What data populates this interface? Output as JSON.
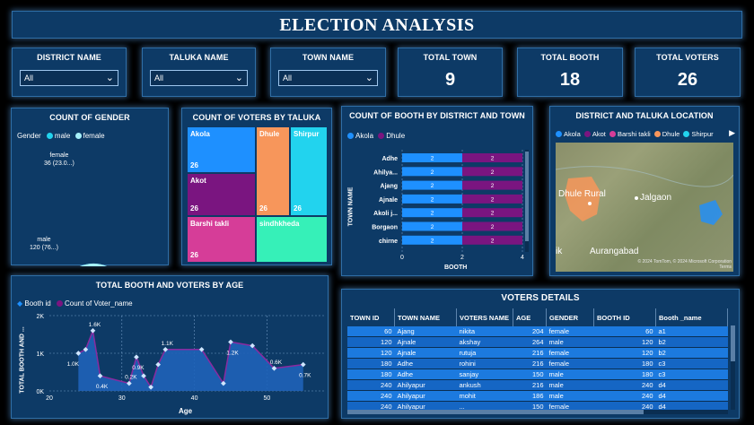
{
  "title": "ELECTION ANALYSIS",
  "filters": [
    {
      "label": "DISTRICT NAME",
      "value": "All"
    },
    {
      "label": "TALUKA NAME",
      "value": "All"
    },
    {
      "label": "TOWN NAME",
      "value": "All"
    }
  ],
  "cards": [
    {
      "label": "TOTAL TOWN",
      "value": "9"
    },
    {
      "label": "TOTAL BOOTH",
      "value": "18"
    },
    {
      "label": "TOTAL VOTERS",
      "value": "26"
    }
  ],
  "gender": {
    "title": "COUNT OF GENDER",
    "legend_title": "Gender",
    "legend": [
      {
        "name": "male",
        "color": "#22d3ee"
      },
      {
        "name": "female",
        "color": "#a5f0fa"
      }
    ],
    "female_label": "female",
    "female_value": "36 (23.0...)",
    "male_label": "male",
    "male_value": "120 (76...)",
    "female_fraction": 0.23
  },
  "treemap": {
    "title": "COUNT OF VOTERS BY  TALUKA",
    "items": [
      {
        "name": "Akola",
        "value": "26",
        "color": "#1e90ff"
      },
      {
        "name": "Dhule",
        "value": "26",
        "color": "#f7965b"
      },
      {
        "name": "Shirpur",
        "value": "26",
        "color": "#22d3ee"
      },
      {
        "name": "Akot",
        "value": "26",
        "color": "#7a1580"
      },
      {
        "name": "Barshi takli",
        "value": "26",
        "color": "#d63d98"
      },
      {
        "name": "sindhkheda",
        "value": "",
        "color": "#36f0b8"
      }
    ]
  },
  "booth_chart": {
    "title": "COUNT OF BOOTH BY DISTRICT AND TOWN",
    "legend": [
      {
        "name": "Akola",
        "color": "#1e90ff"
      },
      {
        "name": "Dhule",
        "color": "#7a1580"
      }
    ],
    "ylabel": "TOWN NAME",
    "xlabel": "BOOTH",
    "towns": [
      "Adhe",
      "Ahilya...",
      "Ajang",
      "Ajnale",
      "Akoli j...",
      "Borgaon",
      "chirne"
    ],
    "akola": [
      2,
      2,
      2,
      2,
      2,
      2,
      2
    ],
    "dhule": [
      2,
      2,
      2,
      2,
      2,
      2,
      2
    ],
    "xticks": [
      "0",
      "2",
      "4"
    ]
  },
  "map": {
    "title": "DISTRICT AND TALUKA LOCATION",
    "legend": [
      {
        "name": "Akola",
        "color": "#1e90ff"
      },
      {
        "name": "Akot",
        "color": "#7a1580"
      },
      {
        "name": "Barshi takli",
        "color": "#d63d98"
      },
      {
        "name": "Dhule",
        "color": "#f7965b"
      },
      {
        "name": "Shirpur",
        "color": "#22d3ee"
      }
    ],
    "place1": "Dhule Rural",
    "place2": "Jalgaon",
    "place3": "Aurangabad",
    "place4": "ik",
    "attribution": "© 2024 TomTom, © 2024 Microsoft Corporation Terms"
  },
  "age_chart": {
    "title": "TOTAL BOOTH AND VOTERS BY AGE",
    "legend": [
      {
        "name": "Booth id",
        "color": "#1e90ff"
      },
      {
        "name": "Count of Voter_name",
        "color": "#7a1580"
      }
    ],
    "ylabel": "TOTAL BOOTH AND ...",
    "xlabel": "Age",
    "yticks": [
      "2K",
      "1K",
      "0K"
    ],
    "xticks": [
      "20",
      "30",
      "40",
      "50"
    ],
    "labels": [
      "1.0K",
      "1.6K",
      "0.4K",
      "0.2K",
      "0.9K",
      "1.1K",
      "1.2K",
      "0.6K",
      "0.7K"
    ]
  },
  "chart_data": [
    {
      "type": "bar",
      "title": "COUNT OF BOOTH BY DISTRICT AND TOWN",
      "categories": [
        "Adhe",
        "Ahilya...",
        "Ajang",
        "Ajnale",
        "Akoli j...",
        "Borgaon",
        "chirne"
      ],
      "series": [
        {
          "name": "Akola",
          "values": [
            2,
            2,
            2,
            2,
            2,
            2,
            2
          ]
        },
        {
          "name": "Dhule",
          "values": [
            2,
            2,
            2,
            2,
            2,
            2,
            2
          ]
        }
      ],
      "xlabel": "BOOTH",
      "ylabel": "TOWN NAME",
      "xlim": [
        0,
        4
      ]
    },
    {
      "type": "area",
      "title": "TOTAL BOOTH AND VOTERS BY AGE",
      "x": [
        24,
        25,
        26,
        27,
        31,
        32,
        33,
        34,
        35,
        36,
        41,
        44,
        45,
        48,
        51,
        55
      ],
      "series": [
        {
          "name": "Booth id",
          "values": [
            1000,
            1100,
            1600,
            400,
            200,
            900,
            400,
            100,
            700,
            1100,
            1100,
            200,
            1300,
            1200,
            600,
            700
          ]
        },
        {
          "name": "Count of Voter_name",
          "values": [
            1000,
            1100,
            1600,
            400,
            200,
            900,
            400,
            100,
            700,
            1100,
            1100,
            200,
            1300,
            1200,
            600,
            700
          ]
        }
      ],
      "xlabel": "Age",
      "ylabel": "TOTAL BOOTH AND ...",
      "ylim": [
        0,
        2000
      ]
    },
    {
      "type": "pie",
      "title": "COUNT OF GENDER",
      "categories": [
        "male",
        "female"
      ],
      "values": [
        120,
        36
      ]
    }
  ],
  "table": {
    "title": "VOTERS DETAILS",
    "columns": [
      "TOWN ID",
      "TOWN NAME",
      "VOTERS NAME",
      "AGE",
      "GENDER",
      "BOOTH ID",
      "Booth _name"
    ],
    "rows": [
      [
        "60",
        "Ajang",
        "nikita",
        "204",
        "female",
        "60",
        "a1"
      ],
      [
        "120",
        "Ajnale",
        "akshay",
        "264",
        "male",
        "120",
        "b2"
      ],
      [
        "120",
        "Ajnale",
        "rutuja",
        "216",
        "female",
        "120",
        "b2"
      ],
      [
        "180",
        "Adhe",
        "rohini",
        "216",
        "female",
        "180",
        "c3"
      ],
      [
        "180",
        "Adhe",
        "sanjay",
        "150",
        "male",
        "180",
        "c3"
      ],
      [
        "240",
        "Ahilyapur",
        "ankush",
        "216",
        "male",
        "240",
        "d4"
      ],
      [
        "240",
        "Ahilyapur",
        "mohit",
        "186",
        "male",
        "240",
        "d4"
      ],
      [
        "240",
        "Ahilyapur",
        "...",
        "150",
        "female",
        "240",
        "d4"
      ]
    ]
  }
}
